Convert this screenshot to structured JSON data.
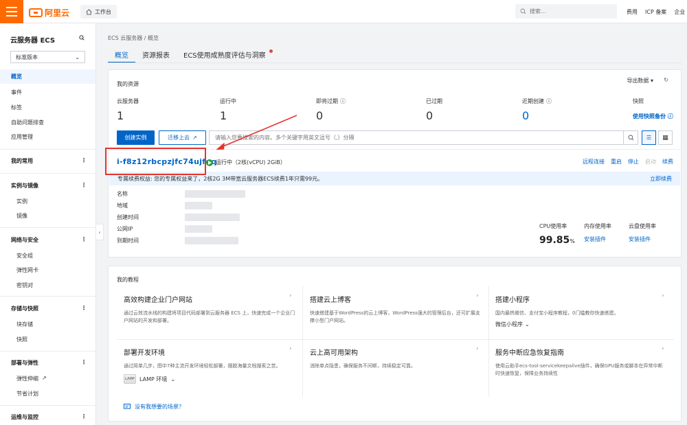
{
  "topbar": {
    "logo_text": "阿里云",
    "workbench_label": "工作台",
    "search_placeholder": "搜索...",
    "links": [
      "费用",
      "ICP 备案",
      "企业"
    ]
  },
  "sidebar": {
    "title": "云服务器 ECS",
    "version_select": "标准版本",
    "items": [
      "概览",
      "事件",
      "标签",
      "自助问题排查",
      "应用管理"
    ],
    "groups": [
      {
        "label": "我的常用",
        "children": []
      },
      {
        "label": "实例与镜像",
        "children": [
          "实例",
          "镜像"
        ]
      },
      {
        "label": "网络与安全",
        "children": [
          "安全组",
          "弹性网卡",
          "密钥对"
        ]
      },
      {
        "label": "存储与快照",
        "children": [
          "块存储",
          "快照"
        ]
      },
      {
        "label": "部署与弹性",
        "children": [
          "弹性伸缩",
          "节省计划"
        ]
      },
      {
        "label": "运维与监控",
        "children": []
      }
    ]
  },
  "main": {
    "breadcrumb": "ECS 云服务器  /  概览",
    "tabs": [
      "概览",
      "资源报表",
      "ECS使用成熟度评估与洞察"
    ]
  },
  "resources": {
    "title": "我的资源",
    "export_label": "导出数据",
    "stats": [
      {
        "label": "云服务器",
        "value": "1"
      },
      {
        "label": "运行中",
        "value": "1"
      },
      {
        "label": "即将过期",
        "value": "0"
      },
      {
        "label": "已过期",
        "value": "0"
      },
      {
        "label": "近期创建",
        "value": "0"
      }
    ],
    "snapshot_label": "快照",
    "snapshot_link": "使用快照备份",
    "create_button": "创建实例",
    "migrate_button": "迁移上云",
    "search_placeholder": "请输入您要搜索的内容。多个关键字用英文逗号（,）分隔",
    "instance": {
      "id": "i-f8z12rbcpzjfc74ujfqq",
      "status": "运行中（2核(vCPU) 2GiB）",
      "actions": [
        "远程连接",
        "重启",
        "停止",
        "启动",
        "续费"
      ],
      "banner_text": "专属续费权益: 您的专属权益来了，2核2G 3M带宽云服务器ECS续费1年只需99元。",
      "banner_link": "立即续费",
      "fields": [
        "名称",
        "地域",
        "创建时间",
        "公网IP",
        "到期时间"
      ],
      "cpu_label": "CPU使用率",
      "cpu_value": "99.85",
      "cpu_unit": "%",
      "mem_label": "内存使用率",
      "mem_link": "安装插件",
      "disk_label": "云盘使用率",
      "disk_link": "安装插件"
    }
  },
  "tutorials": {
    "title": "我的教程",
    "items": [
      {
        "title": "高效构建企业门户网站",
        "desc": "通过云效流水线的构建将项目代码部署到云服务器 ECS 上，快速完成一个企业门户网站的开发和部署。"
      },
      {
        "title": "搭建云上博客",
        "desc": "快速搭建基于WordPress的云上博客，WordPress强大的管理后台，还可扩展支撑小型门户网站。"
      },
      {
        "title": "搭建小程序",
        "desc": "国内最热微信、支付宝小程序教程，0门槛教你快速搭建。",
        "select": "微信小程序"
      },
      {
        "title": "部署开发环境",
        "desc": "通过简单几步，图中7种主流开发环境轻松部署，摆脱海量文档搜索之苦。",
        "select": "LAMP 环境",
        "icon_text": "LAMP"
      },
      {
        "title": "云上高可用架构",
        "desc": "消除单点隐患，确保服务不间断，持续稳定可靠。"
      },
      {
        "title": "服务中断应急恢复指南",
        "desc": "使用云助手ecs-tool-servicekeepalive插件，确保GPU服务或脚本在异常中断时快速恢复，保障业务持续性"
      }
    ],
    "feedback": "没有我想要的场景？"
  }
}
